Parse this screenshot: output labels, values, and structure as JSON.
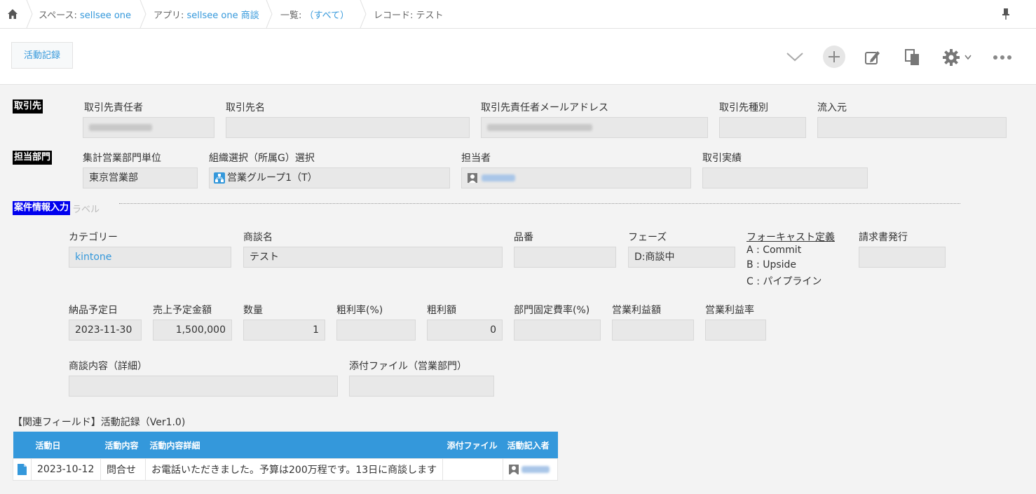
{
  "breadcrumb": {
    "space_prefix": "スペース: ",
    "space_name": "sellsee one",
    "app_prefix": "アプリ: ",
    "app_name": "sellsee one 商談",
    "list_prefix": "一覧: ",
    "list_name": "（すべて）",
    "record": "レコード: テスト"
  },
  "toolbar": {
    "activity_button": "活動記録"
  },
  "sections": {
    "client": "取引先",
    "department": "担当部門",
    "deal_input": "案件情報入力",
    "deal_input_ghost": "ラベル"
  },
  "client": {
    "contact_label": "取引先責任者",
    "name_label": "取引先名",
    "email_label": "取引先責任者メールアドレス",
    "type_label": "取引先種別",
    "source_label": "流入元"
  },
  "department": {
    "unit_label": "集計営業部門単位",
    "unit_value": "東京営業部",
    "org_label": "組織選択（所属G）選択",
    "org_value": "営業グループ1（T）",
    "owner_label": "担当者",
    "results_label": "取引実績"
  },
  "deal": {
    "category_label": "カテゴリー",
    "category_value": "kintone",
    "name_label": "商談名",
    "name_value": "テスト",
    "part_label": "品番",
    "phase_label": "フェーズ",
    "phase_value": "D:商談中",
    "forecast_title": "フォーキャスト定義",
    "forecast_a": "A : Commit",
    "forecast_b": "B : Upside",
    "forecast_c": "C : パイプライン",
    "invoice_label": "請求書発行",
    "delivery_label": "納品予定日",
    "delivery_value": "2023-11-30",
    "amount_label": "売上予定金額",
    "amount_value": "1,500,000",
    "qty_label": "数量",
    "qty_value": "1",
    "margin_rate_label": "粗利率(%)",
    "margin_label": "粗利額",
    "margin_value": "0",
    "fixed_rate_label": "部門固定費率(%)",
    "op_profit_label": "営業利益額",
    "op_rate_label": "営業利益率",
    "detail_label": "商談内容（詳細）",
    "attach_label": "添付ファイル（営業部門）"
  },
  "related": {
    "title": "【関連フィールド】活動記録（Ver1.0)",
    "headers": [
      "活動日",
      "活動内容",
      "活動内容詳細",
      "添付ファイル",
      "活動記入者"
    ],
    "rows": [
      {
        "date": "2023-10-12",
        "type": "問合せ",
        "detail": "お電話いただきました。予算は200万程です。13日に商談します",
        "attach": ""
      }
    ]
  },
  "colors": {
    "accent": "#3498db",
    "section_black": "#000000",
    "section_blue": "#0000ee"
  }
}
